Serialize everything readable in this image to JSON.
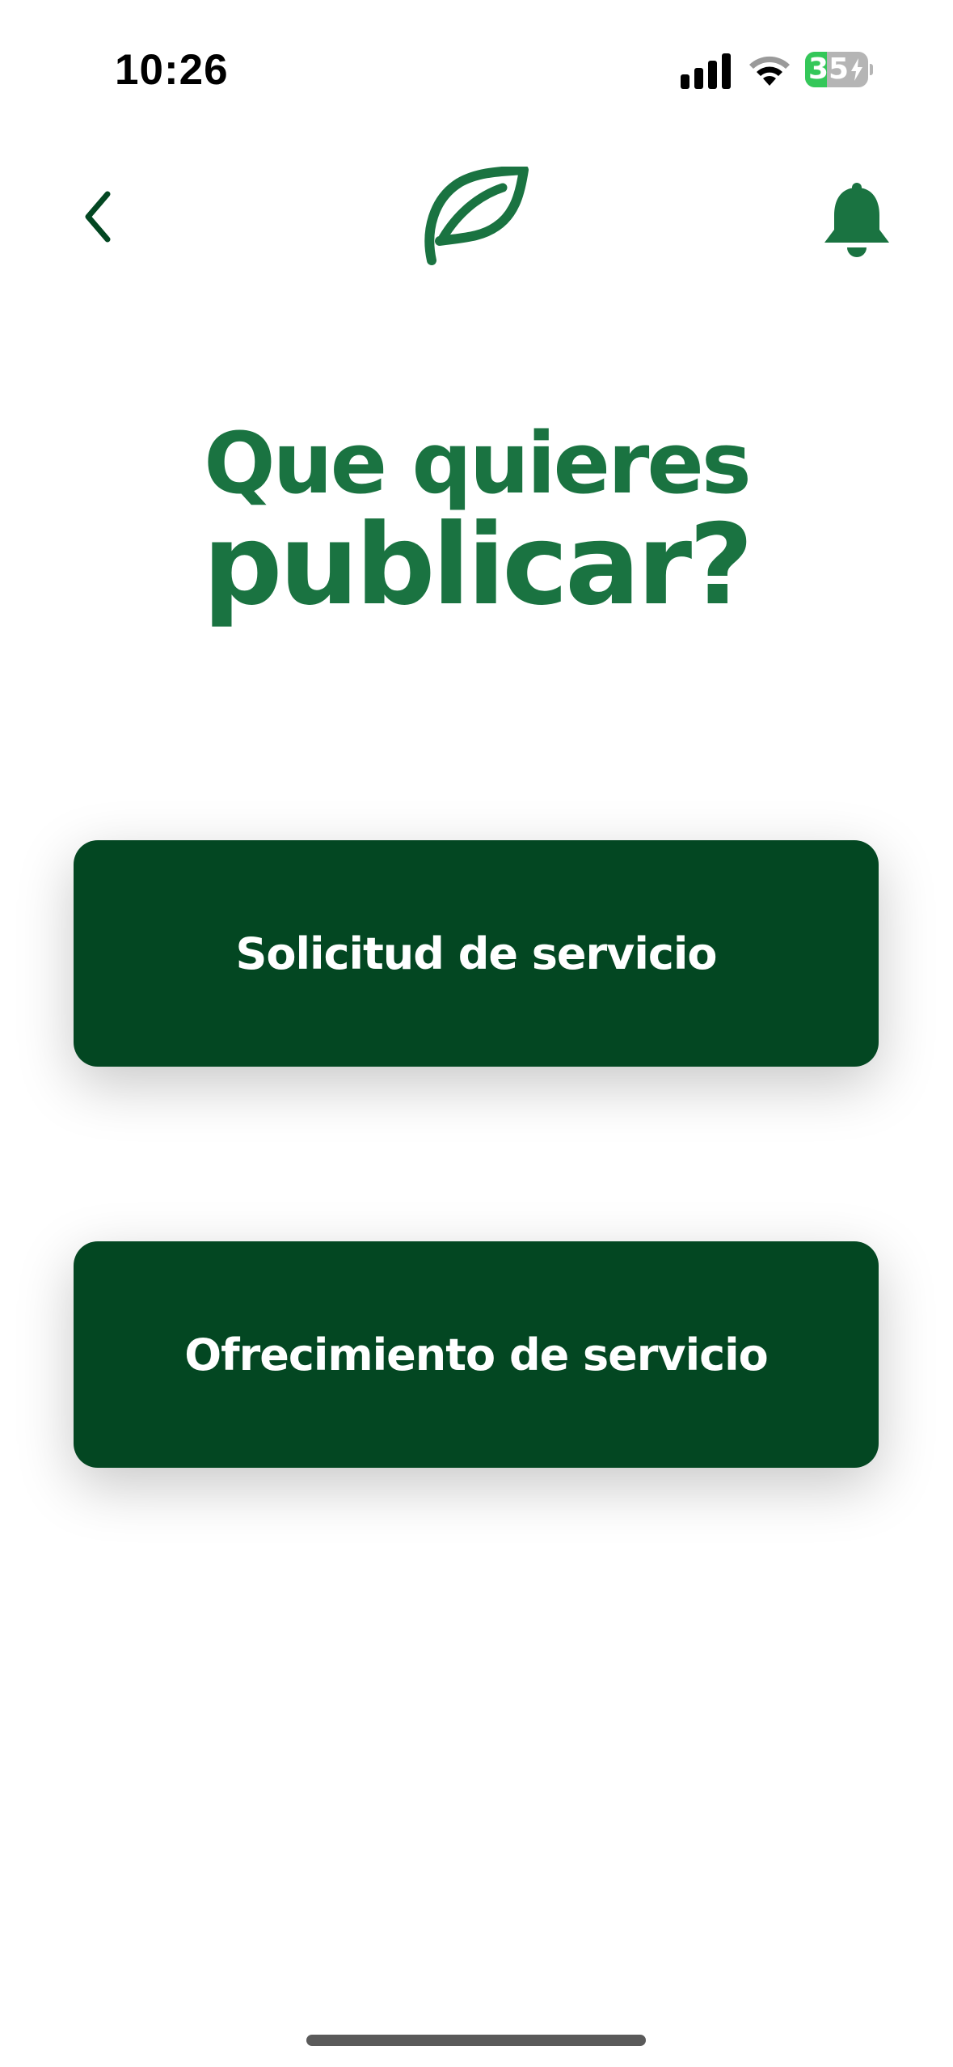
{
  "status_bar": {
    "time": "10:26",
    "battery_level": "35",
    "battery_fraction": 0.35,
    "icons": [
      "cellular-signal-icon",
      "wifi-icon",
      "battery-icon"
    ]
  },
  "header": {
    "back_icon": "chevron-left-icon",
    "logo_icon": "leaf-icon",
    "notifications_icon": "bell-icon"
  },
  "title": {
    "line1": "Que quieres",
    "line2": "publicar?"
  },
  "buttons": {
    "request_label": "Solicitud de servicio",
    "offer_label": "Ofrecimiento de servicio"
  },
  "colors": {
    "brand_green": "#1a7341",
    "button_green": "#034722",
    "battery_green": "#34c759"
  }
}
